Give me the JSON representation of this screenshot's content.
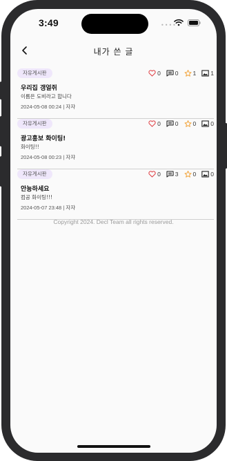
{
  "statusbar": {
    "time": "3:49"
  },
  "header": {
    "title": "내가 쓴 글"
  },
  "posts": [
    {
      "category": "자유게시판",
      "title": "우리집 갱얼쥐",
      "body": "이름은 도비라고 합니다",
      "date": "2024-05-08 00:24",
      "separator": "|",
      "author": "자쟈",
      "likes": "0",
      "comments": "0",
      "stars": "1",
      "images": "1"
    },
    {
      "category": "자유게시판",
      "title": "광고홍보 화이팅!",
      "body": "화이팅!!",
      "date": "2024-05-08 00:23",
      "separator": "|",
      "author": "자쟈",
      "likes": "0",
      "comments": "0",
      "stars": "0",
      "images": "0"
    },
    {
      "category": "자유게시판",
      "title": "안뇽하세요",
      "body": "컴공 화이팅!!!",
      "date": "2024-05-07 23:48",
      "separator": "|",
      "author": "자쟈",
      "likes": "0",
      "comments": "3",
      "stars": "0",
      "images": "0"
    }
  ],
  "footer": {
    "copyright": "Copyright 2024. Decl Team all rights reserved."
  },
  "icons": {
    "like": "heart-icon",
    "comment": "comment-icon",
    "star": "star-icon",
    "image": "image-icon",
    "back": "chevron-left-icon"
  },
  "colors": {
    "heart": "#e0474c",
    "star": "#f2a33a",
    "badge_bg": "#efe7fb",
    "screen_bg": "#fafafa"
  }
}
